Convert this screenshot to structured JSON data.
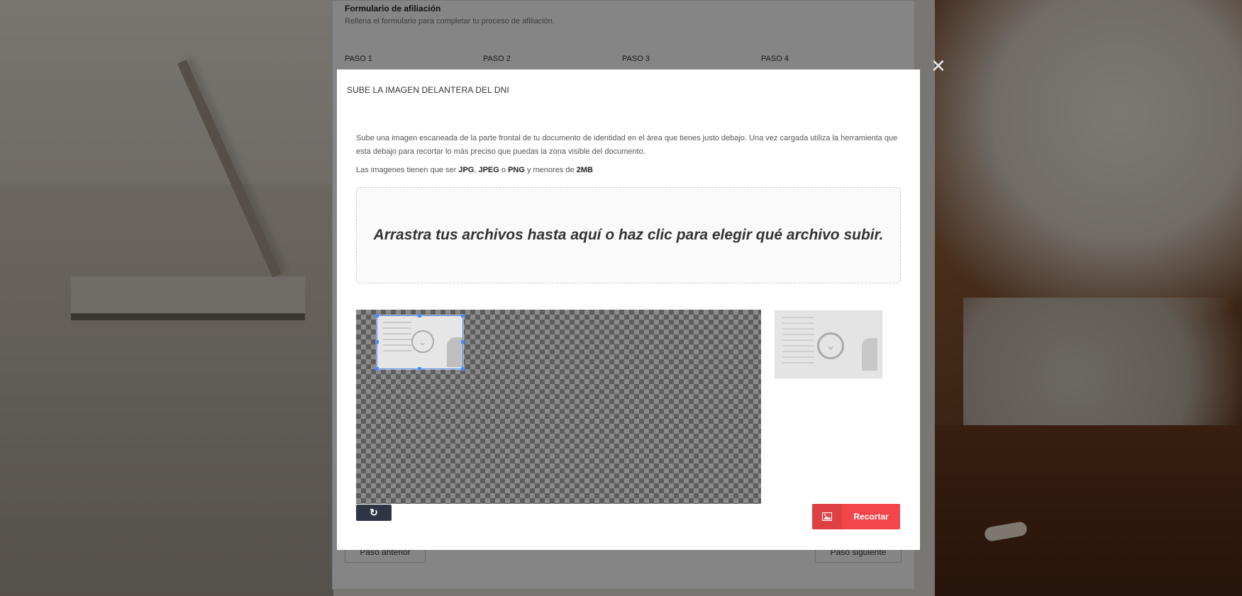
{
  "page": {
    "title": "Formulario de afiliación",
    "subtitle": "Rellena el formulario para completar tu proceso de afiliación.",
    "steps": [
      "PASO 1",
      "PASO 2",
      "PASO 3",
      "PASO 4"
    ],
    "prev_label": "Paso anterior",
    "next_label": "Paso siguiente"
  },
  "modal": {
    "close_icon": "close-icon",
    "title": "SUBE LA IMAGEN DELANTERA DEL DNI",
    "description": "Sube una imagen escaneada de la parte frontal de tu documento de identidad en el área que tienes justo debajo. Una vez cargada utiliza la herramienta que esta debajo para recortar lo más preciso que puedas la zona visible del documento.",
    "requirements_prefix": "Las imagenes tienen que ser",
    "formats": [
      "JPG",
      "JPEG",
      "PNG"
    ],
    "format_sep_1": ", ",
    "format_sep_2": " o ",
    "size_prefix": " y menores de ",
    "max_size": "2MB",
    "dropzone_text": "Arrastra tus archivos hasta aquí o haz clic para elegir qué archivo subir.",
    "reset_icon": "refresh-icon",
    "crop_icon": "image-icon",
    "crop_label": "Recortar"
  },
  "colors": {
    "accent": "#f2464a",
    "dark_button": "#2f3545",
    "crop_handles": "#4c8cf5"
  }
}
